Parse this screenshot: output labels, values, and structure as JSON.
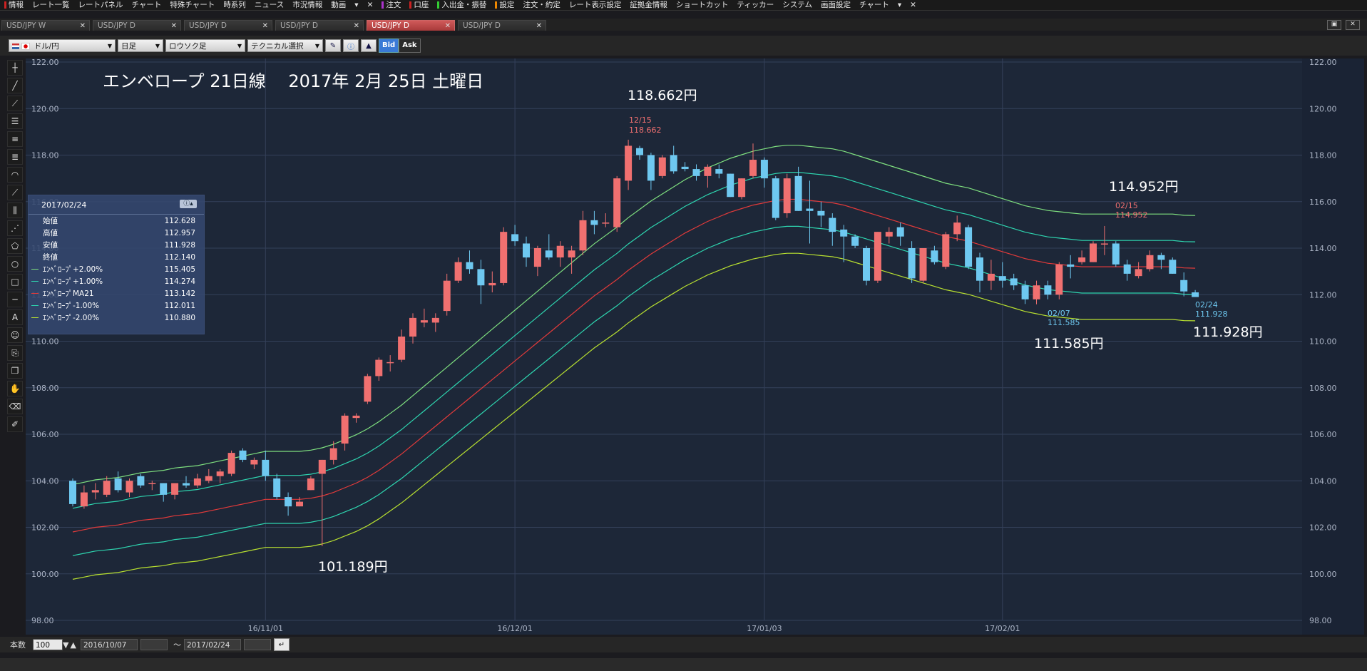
{
  "menu": {
    "items": [
      {
        "label": "情報",
        "color": "#c22"
      },
      {
        "label": "レート一覧",
        "color": ""
      },
      {
        "label": "レートパネル",
        "color": ""
      },
      {
        "label": "チャート",
        "color": ""
      },
      {
        "label": "特殊チャート",
        "color": ""
      },
      {
        "label": "時系列",
        "color": ""
      },
      {
        "label": "ニュース",
        "color": ""
      },
      {
        "label": "市況情報",
        "color": ""
      },
      {
        "label": "動画",
        "color": ""
      },
      {
        "label": "▾",
        "color": ""
      },
      {
        "label": "✕",
        "color": ""
      },
      {
        "label": "注文",
        "color": "#a3c"
      },
      {
        "label": "口座",
        "color": "#c22"
      },
      {
        "label": "入出金・振替",
        "color": "#3c3"
      },
      {
        "label": "設定",
        "color": "#e80"
      },
      {
        "label": "注文・約定",
        "color": ""
      },
      {
        "label": "レート表示設定",
        "color": ""
      },
      {
        "label": "証拠金情報",
        "color": ""
      },
      {
        "label": "ショートカット",
        "color": ""
      },
      {
        "label": "ティッカー",
        "color": ""
      },
      {
        "label": "システム",
        "color": ""
      },
      {
        "label": "画面設定",
        "color": ""
      },
      {
        "label": "チャート",
        "color": ""
      },
      {
        "label": "▾",
        "color": ""
      },
      {
        "label": "✕",
        "color": ""
      }
    ]
  },
  "tabs": [
    {
      "label": "USD/JPY W",
      "active": false
    },
    {
      "label": "USD/JPY D",
      "active": false
    },
    {
      "label": "USD/JPY D",
      "active": false
    },
    {
      "label": "USD/JPY D",
      "active": false
    },
    {
      "label": "USD/JPY D",
      "active": true
    },
    {
      "label": "USD/JPY D",
      "active": false
    }
  ],
  "toolbar": {
    "pair": "ドル/円",
    "period": "日足",
    "charttype": "ロウソク足",
    "technical": "テクニカル選択",
    "bid": "Bid",
    "ask": "Ask"
  },
  "info": {
    "date": "2017/02/24",
    "rows": [
      {
        "label": "始値",
        "value": "112.628",
        "color": ""
      },
      {
        "label": "高値",
        "value": "112.957",
        "color": ""
      },
      {
        "label": "安値",
        "value": "111.928",
        "color": ""
      },
      {
        "label": "終値",
        "value": "112.140",
        "color": ""
      },
      {
        "label": "ｴﾝﾍﾞﾛｰﾌﾟ+2.00%",
        "value": "115.405",
        "color": "#7fe07f"
      },
      {
        "label": "ｴﾝﾍﾞﾛｰﾌﾟ+1.00%",
        "value": "114.274",
        "color": "#2ed6b0"
      },
      {
        "label": "ｴﾝﾍﾞﾛｰﾌﾟMA21",
        "value": "113.142",
        "color": "#e23a3a"
      },
      {
        "label": "ｴﾝﾍﾞﾛｰﾌﾟ-1.00%",
        "value": "112.011",
        "color": "#2ed6b0"
      },
      {
        "label": "ｴﾝﾍﾞﾛｰﾌﾟ-2.00%",
        "value": "110.880",
        "color": "#b8e030"
      }
    ]
  },
  "status": {
    "count_label": "本数",
    "count": "100",
    "from": "2016/10/07",
    "tilde": "〜",
    "to": "2017/02/24"
  },
  "chart_data": {
    "type": "candlestick",
    "title": "エンベロープ 21日線　 2017年 2月 25日 土曜日",
    "ylim": [
      98,
      122
    ],
    "yticks": [
      "122.00",
      "120.00",
      "118.00",
      "116.00",
      "114.00",
      "112.00",
      "110.00",
      "108.00",
      "106.00",
      "104.00",
      "102.00",
      "100.00",
      "98.00"
    ],
    "xticks": [
      {
        "label": "16/11/01",
        "index": 17
      },
      {
        "label": "16/12/01",
        "index": 39
      },
      {
        "label": "17/01/03",
        "index": 61
      },
      {
        "label": "17/02/01",
        "index": 82
      }
    ],
    "grid": true,
    "up_color": "#f07070",
    "down_color": "#6ec8f0",
    "candles": [
      {
        "o": 104.0,
        "h": 104.1,
        "l": 102.9,
        "c": 103.0
      },
      {
        "o": 102.9,
        "h": 103.8,
        "l": 102.8,
        "c": 103.5
      },
      {
        "o": 103.5,
        "h": 103.9,
        "l": 103.2,
        "c": 103.6
      },
      {
        "o": 103.4,
        "h": 104.2,
        "l": 103.3,
        "c": 104.0
      },
      {
        "o": 104.1,
        "h": 104.4,
        "l": 103.5,
        "c": 103.6
      },
      {
        "o": 103.5,
        "h": 104.1,
        "l": 103.3,
        "c": 104.0
      },
      {
        "o": 104.2,
        "h": 104.3,
        "l": 103.7,
        "c": 103.8
      },
      {
        "o": 103.9,
        "h": 104.0,
        "l": 103.6,
        "c": 103.9
      },
      {
        "o": 103.9,
        "h": 103.9,
        "l": 103.1,
        "c": 103.4
      },
      {
        "o": 103.4,
        "h": 103.9,
        "l": 103.2,
        "c": 103.9
      },
      {
        "o": 103.9,
        "h": 104.2,
        "l": 103.7,
        "c": 103.8
      },
      {
        "o": 103.8,
        "h": 104.3,
        "l": 103.7,
        "c": 104.1
      },
      {
        "o": 104.0,
        "h": 104.5,
        "l": 103.9,
        "c": 104.2
      },
      {
        "o": 104.2,
        "h": 104.5,
        "l": 103.9,
        "c": 104.4
      },
      {
        "o": 104.3,
        "h": 105.3,
        "l": 104.2,
        "c": 105.2
      },
      {
        "o": 105.3,
        "h": 105.4,
        "l": 104.8,
        "c": 104.9
      },
      {
        "o": 104.7,
        "h": 105.0,
        "l": 104.5,
        "c": 104.9
      },
      {
        "o": 104.9,
        "h": 105.3,
        "l": 104.0,
        "c": 104.2
      },
      {
        "o": 104.1,
        "h": 104.3,
        "l": 103.2,
        "c": 103.3
      },
      {
        "o": 103.3,
        "h": 103.5,
        "l": 102.5,
        "c": 102.9
      },
      {
        "o": 102.9,
        "h": 103.3,
        "l": 102.9,
        "c": 103.1
      },
      {
        "o": 103.6,
        "h": 104.2,
        "l": 103.6,
        "c": 104.1
      },
      {
        "o": 104.3,
        "h": 104.9,
        "l": 101.189,
        "c": 104.9
      },
      {
        "o": 104.9,
        "h": 105.7,
        "l": 104.7,
        "c": 105.4
      },
      {
        "o": 105.6,
        "h": 106.9,
        "l": 105.3,
        "c": 106.8
      },
      {
        "o": 106.7,
        "h": 106.9,
        "l": 106.5,
        "c": 106.8
      },
      {
        "o": 107.4,
        "h": 108.6,
        "l": 107.3,
        "c": 108.5
      },
      {
        "o": 108.5,
        "h": 109.3,
        "l": 108.3,
        "c": 109.2
      },
      {
        "o": 109.1,
        "h": 109.4,
        "l": 108.7,
        "c": 109.1
      },
      {
        "o": 109.2,
        "h": 110.5,
        "l": 109.1,
        "c": 110.2
      },
      {
        "o": 110.2,
        "h": 111.2,
        "l": 109.9,
        "c": 111.0
      },
      {
        "o": 110.8,
        "h": 111.4,
        "l": 110.6,
        "c": 110.9
      },
      {
        "o": 110.8,
        "h": 111.2,
        "l": 110.4,
        "c": 111.0
      },
      {
        "o": 111.3,
        "h": 112.9,
        "l": 111.1,
        "c": 112.6
      },
      {
        "o": 112.6,
        "h": 113.6,
        "l": 112.5,
        "c": 113.4
      },
      {
        "o": 113.4,
        "h": 113.9,
        "l": 112.9,
        "c": 113.1
      },
      {
        "o": 113.1,
        "h": 113.5,
        "l": 111.6,
        "c": 112.4
      },
      {
        "o": 112.4,
        "h": 113.0,
        "l": 112.1,
        "c": 112.5
      },
      {
        "o": 112.5,
        "h": 114.9,
        "l": 112.4,
        "c": 114.7
      },
      {
        "o": 114.6,
        "h": 115.0,
        "l": 114.1,
        "c": 114.3
      },
      {
        "o": 114.2,
        "h": 114.5,
        "l": 113.2,
        "c": 113.6
      },
      {
        "o": 113.2,
        "h": 114.1,
        "l": 112.8,
        "c": 114.0
      },
      {
        "o": 113.9,
        "h": 114.6,
        "l": 113.5,
        "c": 113.6
      },
      {
        "o": 113.6,
        "h": 114.3,
        "l": 113.2,
        "c": 114.1
      },
      {
        "o": 113.6,
        "h": 114.1,
        "l": 112.9,
        "c": 113.9
      },
      {
        "o": 113.9,
        "h": 115.6,
        "l": 113.7,
        "c": 115.2
      },
      {
        "o": 115.2,
        "h": 115.6,
        "l": 114.6,
        "c": 115.0
      },
      {
        "o": 115.1,
        "h": 115.5,
        "l": 114.9,
        "c": 115.1
      },
      {
        "o": 114.9,
        "h": 117.1,
        "l": 114.7,
        "c": 117.0
      },
      {
        "o": 116.9,
        "h": 118.662,
        "l": 116.5,
        "c": 118.4
      },
      {
        "o": 118.3,
        "h": 118.4,
        "l": 117.8,
        "c": 118.0
      },
      {
        "o": 118.0,
        "h": 118.1,
        "l": 116.5,
        "c": 116.9
      },
      {
        "o": 117.1,
        "h": 118.0,
        "l": 117.0,
        "c": 117.9
      },
      {
        "o": 118.0,
        "h": 118.4,
        "l": 117.2,
        "c": 117.3
      },
      {
        "o": 117.5,
        "h": 117.7,
        "l": 117.3,
        "c": 117.4
      },
      {
        "o": 117.4,
        "h": 117.6,
        "l": 116.9,
        "c": 117.1
      },
      {
        "o": 117.1,
        "h": 117.6,
        "l": 116.6,
        "c": 117.5
      },
      {
        "o": 117.4,
        "h": 117.6,
        "l": 117.0,
        "c": 117.2
      },
      {
        "o": 117.2,
        "h": 117.2,
        "l": 116.2,
        "c": 116.2
      },
      {
        "o": 116.2,
        "h": 117.0,
        "l": 116.1,
        "c": 117.0
      },
      {
        "o": 117.1,
        "h": 118.5,
        "l": 117.0,
        "c": 117.8
      },
      {
        "o": 117.8,
        "h": 117.9,
        "l": 116.6,
        "c": 117.0
      },
      {
        "o": 117.0,
        "h": 117.1,
        "l": 115.2,
        "c": 115.3
      },
      {
        "o": 115.5,
        "h": 117.2,
        "l": 115.3,
        "c": 117.0
      },
      {
        "o": 117.1,
        "h": 117.5,
        "l": 115.6,
        "c": 115.6
      },
      {
        "o": 115.7,
        "h": 116.9,
        "l": 114.2,
        "c": 115.6
      },
      {
        "o": 115.6,
        "h": 116.0,
        "l": 114.9,
        "c": 115.4
      },
      {
        "o": 115.3,
        "h": 115.5,
        "l": 114.1,
        "c": 114.7
      },
      {
        "o": 114.8,
        "h": 115.0,
        "l": 113.4,
        "c": 114.5
      },
      {
        "o": 114.5,
        "h": 114.6,
        "l": 114.0,
        "c": 114.1
      },
      {
        "o": 114.0,
        "h": 114.1,
        "l": 112.4,
        "c": 112.6
      },
      {
        "o": 112.6,
        "h": 114.7,
        "l": 112.5,
        "c": 114.7
      },
      {
        "o": 114.5,
        "h": 114.9,
        "l": 114.2,
        "c": 114.7
      },
      {
        "o": 114.9,
        "h": 115.1,
        "l": 114.1,
        "c": 114.5
      },
      {
        "o": 114.0,
        "h": 114.3,
        "l": 112.5,
        "c": 112.7
      },
      {
        "o": 112.6,
        "h": 114.0,
        "l": 112.5,
        "c": 114.0
      },
      {
        "o": 113.9,
        "h": 114.1,
        "l": 113.3,
        "c": 113.4
      },
      {
        "o": 113.2,
        "h": 114.7,
        "l": 113.1,
        "c": 114.6
      },
      {
        "o": 114.6,
        "h": 115.4,
        "l": 114.3,
        "c": 115.1
      },
      {
        "o": 114.9,
        "h": 115.0,
        "l": 113.1,
        "c": 113.2
      },
      {
        "o": 113.6,
        "h": 113.8,
        "l": 112.1,
        "c": 112.6
      },
      {
        "o": 112.6,
        "h": 113.5,
        "l": 112.2,
        "c": 112.9
      },
      {
        "o": 112.8,
        "h": 113.4,
        "l": 112.3,
        "c": 112.6
      },
      {
        "o": 112.7,
        "h": 112.9,
        "l": 112.2,
        "c": 112.4
      },
      {
        "o": 112.4,
        "h": 112.6,
        "l": 111.6,
        "c": 111.8
      },
      {
        "o": 111.8,
        "h": 112.6,
        "l": 111.585,
        "c": 112.4
      },
      {
        "o": 112.4,
        "h": 112.6,
        "l": 111.8,
        "c": 112.0
      },
      {
        "o": 112.0,
        "h": 113.4,
        "l": 111.8,
        "c": 113.3
      },
      {
        "o": 113.3,
        "h": 113.7,
        "l": 112.7,
        "c": 113.2
      },
      {
        "o": 113.4,
        "h": 113.9,
        "l": 113.3,
        "c": 113.6
      },
      {
        "o": 113.4,
        "h": 114.3,
        "l": 113.4,
        "c": 114.2
      },
      {
        "o": 114.2,
        "h": 114.952,
        "l": 113.7,
        "c": 114.2
      },
      {
        "o": 114.2,
        "h": 114.3,
        "l": 113.2,
        "c": 113.3
      },
      {
        "o": 113.3,
        "h": 113.5,
        "l": 112.6,
        "c": 112.9
      },
      {
        "o": 112.8,
        "h": 113.4,
        "l": 112.7,
        "c": 113.1
      },
      {
        "o": 113.1,
        "h": 113.9,
        "l": 113.0,
        "c": 113.7
      },
      {
        "o": 113.7,
        "h": 113.8,
        "l": 113.1,
        "c": 113.5
      },
      {
        "o": 113.5,
        "h": 113.6,
        "l": 112.9,
        "c": 112.9
      },
      {
        "o": 112.628,
        "h": 112.957,
        "l": 111.928,
        "c": 112.14
      },
      {
        "o": 112.1,
        "h": 112.2,
        "l": 111.9,
        "c": 111.9
      }
    ],
    "ma21": [
      101.8,
      101.9,
      102.0,
      102.05,
      102.1,
      102.2,
      102.3,
      102.35,
      102.4,
      102.5,
      102.55,
      102.6,
      102.7,
      102.8,
      102.9,
      103.0,
      103.1,
      103.2,
      103.2,
      103.2,
      103.2,
      103.25,
      103.35,
      103.5,
      103.7,
      103.9,
      104.15,
      104.45,
      104.8,
      105.15,
      105.55,
      105.95,
      106.35,
      106.75,
      107.15,
      107.55,
      107.95,
      108.35,
      108.75,
      109.15,
      109.55,
      109.95,
      110.35,
      110.75,
      111.15,
      111.55,
      111.95,
      112.3,
      112.65,
      113.05,
      113.4,
      113.75,
      114.05,
      114.35,
      114.65,
      114.9,
      115.15,
      115.35,
      115.55,
      115.7,
      115.85,
      115.95,
      116.05,
      116.1,
      116.1,
      116.05,
      116.0,
      115.95,
      115.85,
      115.7,
      115.55,
      115.4,
      115.25,
      115.1,
      114.95,
      114.8,
      114.65,
      114.5,
      114.4,
      114.3,
      114.15,
      114.0,
      113.85,
      113.7,
      113.55,
      113.45,
      113.35,
      113.3,
      113.25,
      113.2,
      113.2,
      113.2,
      113.2,
      113.2,
      113.2,
      113.2,
      113.2,
      113.2,
      113.15,
      113.14
    ]
  },
  "annotations": {
    "high1_date": "12/15",
    "high1_val": "118.662",
    "high1_big": "118.662円",
    "low1_big": "101.189円",
    "high2_date": "02/15",
    "high2_val": "114.952",
    "high2_big": "114.952円",
    "low2_date": "02/07",
    "low2_val": "111.585",
    "low2_big": "111.585円",
    "last_date": "02/24",
    "last_val": "111.928",
    "last_big": "111.928円"
  },
  "colors": {
    "bg": "#1d2738",
    "grid": "#34405a",
    "env2": "#7fe07f",
    "env1": "#2ed6b0",
    "ma": "#e23a3a",
    "envm2": "#b8e030"
  }
}
